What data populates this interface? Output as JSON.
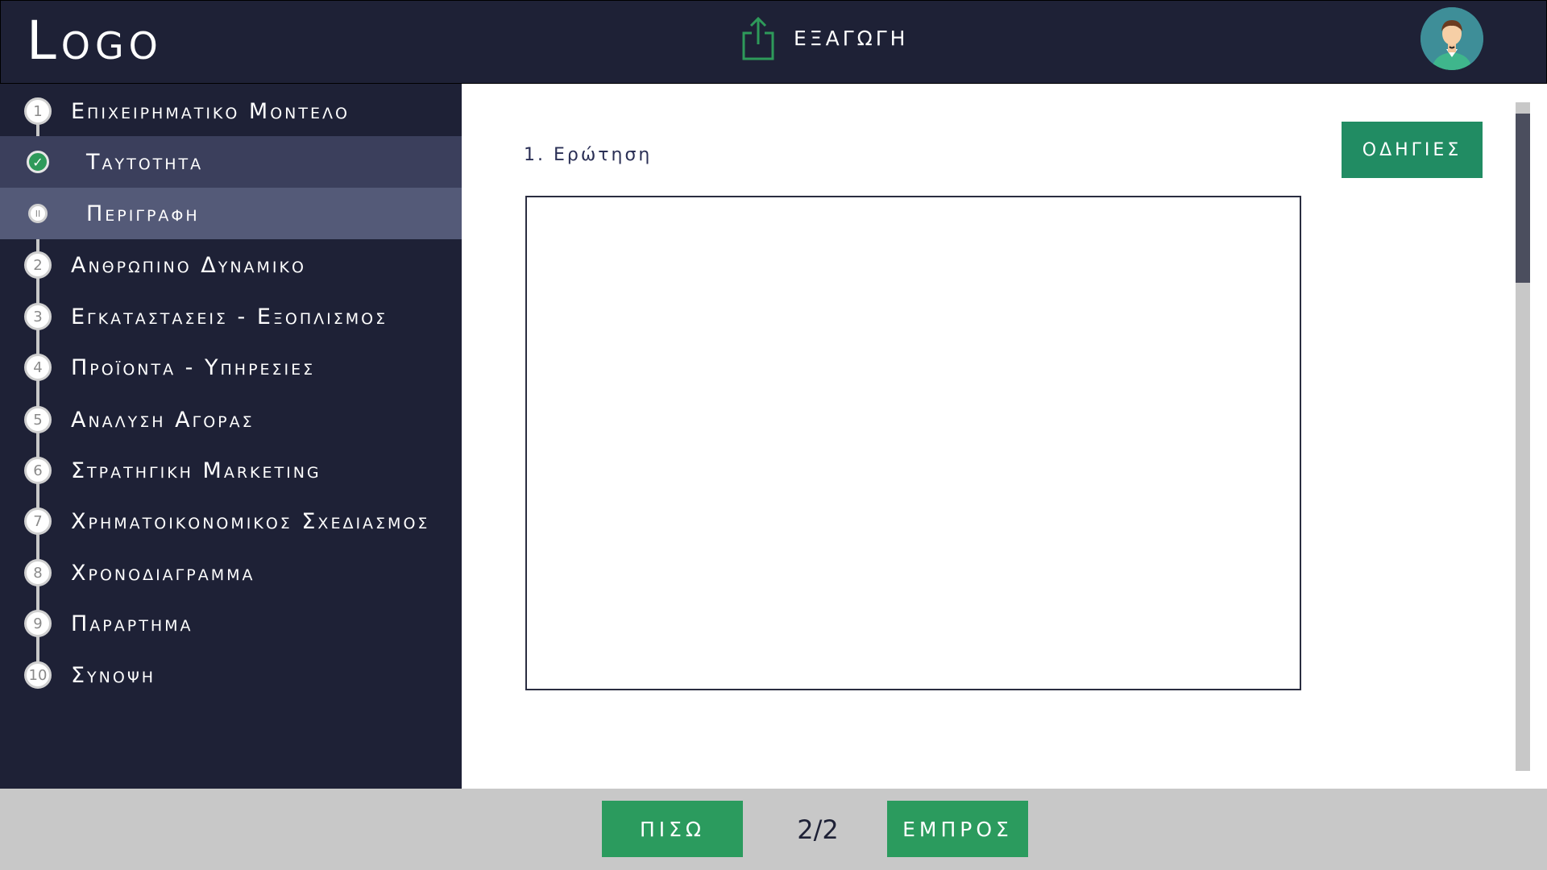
{
  "header": {
    "logo": "Logo",
    "export_label": "ΕΞΑΓΩΓΗ"
  },
  "sidebar": {
    "items": [
      {
        "num": "1",
        "label": "Επιχειρηματικο Μοντελο"
      },
      {
        "num": "",
        "label": "Ταυτοτητα",
        "status": "completed"
      },
      {
        "num": "II",
        "label": "Περιγραφη",
        "status": "current"
      },
      {
        "num": "2",
        "label": "Ανθρωπινο Δυναμικο"
      },
      {
        "num": "3",
        "label": "Εγκαταστασεις - Εξοπλισμος"
      },
      {
        "num": "4",
        "label": "Προϊοντα - Υπηρεσιες"
      },
      {
        "num": "5",
        "label": "Αναλυση Αγορας"
      },
      {
        "num": "6",
        "label": "Στρατηγικη Marketing"
      },
      {
        "num": "7",
        "label": "Χρηματοικονομικος Σχεδιασμος"
      },
      {
        "num": "8",
        "label": "Χρονοδιαγραμμα"
      },
      {
        "num": "9",
        "label": "Παραρτημα"
      },
      {
        "num": "10",
        "label": "Συνοψη"
      }
    ]
  },
  "main": {
    "question_label": "1. Ερώτηση",
    "answer_value": "",
    "instructions_label": "ΟΔΗΓΙΕΣ"
  },
  "footer": {
    "back_label": "ΠΙΣΩ",
    "page_counter": "2/2",
    "next_label": "ΕΜΠΡΟΣ"
  },
  "colors": {
    "navy": "#1e2136",
    "green": "#2b9b5e",
    "instructions_green": "#218c63",
    "footer_gray": "#c8c8c8"
  }
}
